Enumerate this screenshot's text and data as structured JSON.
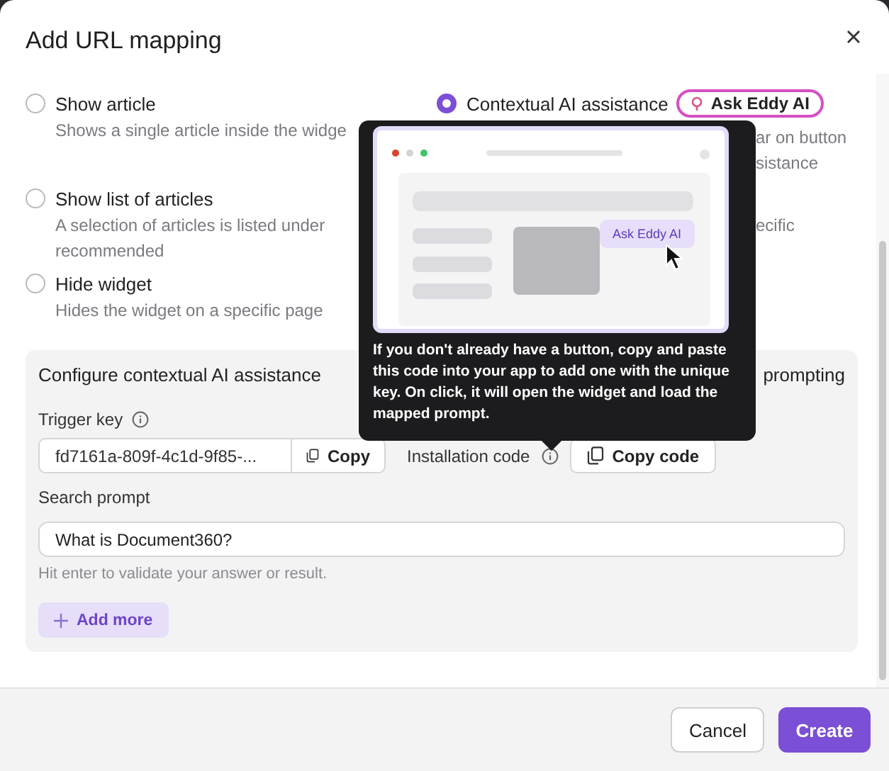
{
  "dialog": {
    "title": "Add URL mapping"
  },
  "options": [
    {
      "label": "Show article",
      "description": "Shows a single article inside the widge",
      "selected": false
    },
    {
      "label": "Show list of articles",
      "description": "A selection of articles is listed under recommended",
      "selected": false
    },
    {
      "label": "Hide widget",
      "description": "Hides the widget on a specific page",
      "selected": false
    }
  ],
  "contextual_option": {
    "label": "Contextual AI assistance",
    "selected": true,
    "badge": "Ask Eddy AI",
    "description_lines": [
      "ar on button",
      "sistance"
    ],
    "fragment": "ecific"
  },
  "config": {
    "title": "Configure contextual AI assistance",
    "title_fragment": "prompting",
    "trigger_key": {
      "label": "Trigger key",
      "value": "fd7161a-809f-4c1d-9f85-...",
      "button": "Copy"
    },
    "installation_code": {
      "label": "Installation code",
      "button": "Copy code"
    },
    "search_prompt": {
      "label": "Search prompt",
      "value": "What is Document360?",
      "hint": "Hit enter to validate your answer or result."
    },
    "add_more": "Add more"
  },
  "tooltip": {
    "text": "If you don't already have a button, copy and paste this code into your app to add one with the unique key. On click, it will open the widget and load the mapped prompt.",
    "illustration_button": "Ask Eddy AI"
  },
  "footer": {
    "buttons": [
      {
        "label": "Cancel",
        "kind": "secondary"
      },
      {
        "label": "Create",
        "kind": "primary"
      }
    ]
  }
}
